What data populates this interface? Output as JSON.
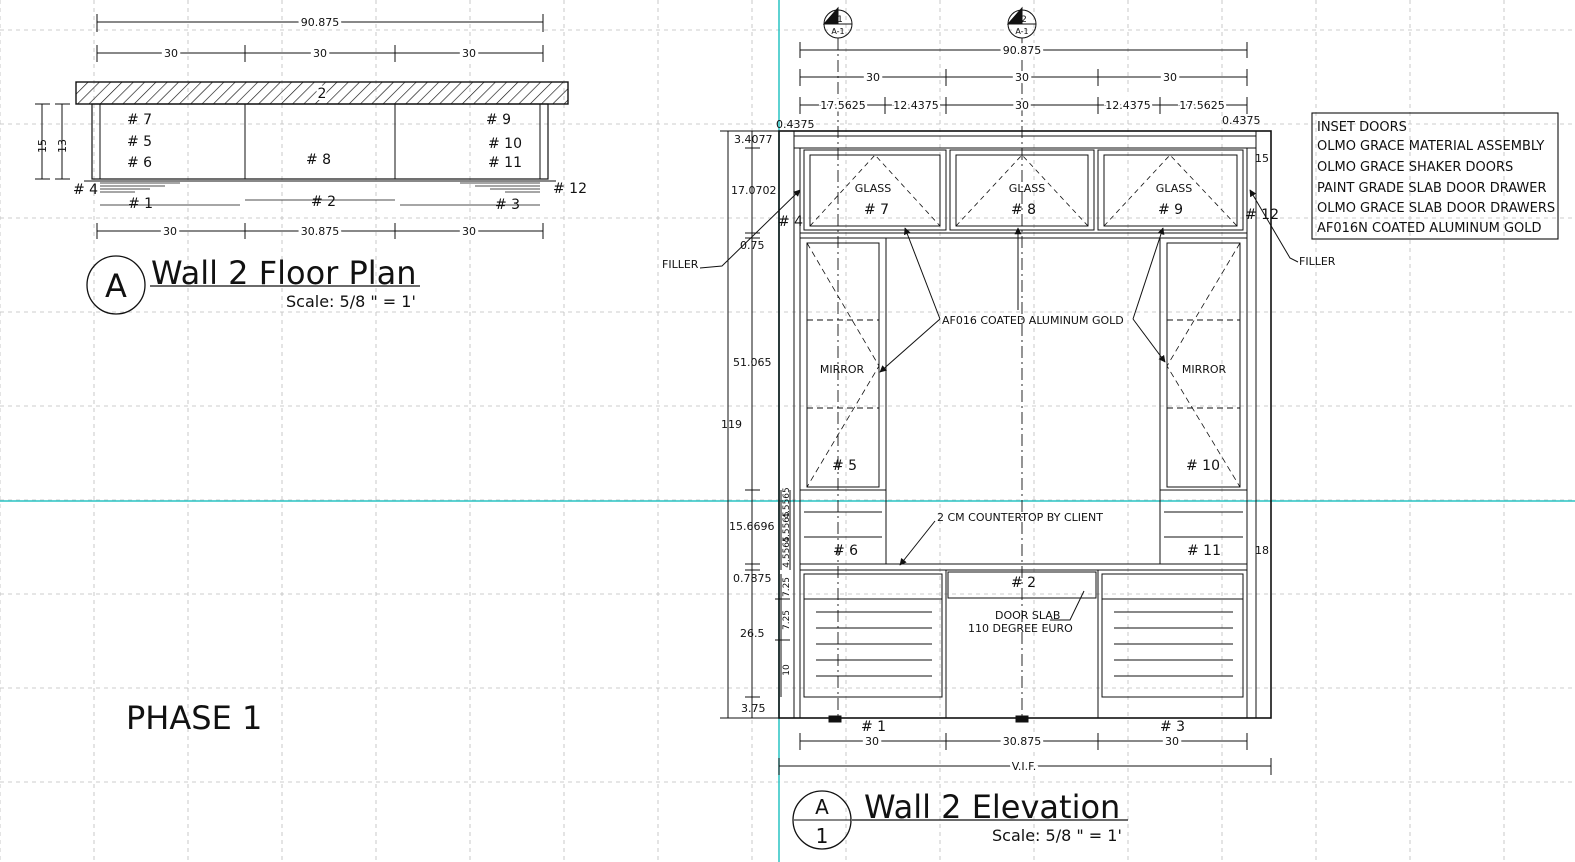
{
  "floor_plan": {
    "dims_top": {
      "overall": "90.875",
      "segments": [
        "30",
        "30",
        "30"
      ]
    },
    "dims_bottom": [
      "30",
      "30.875",
      "30"
    ],
    "dims_side": [
      "15",
      "13"
    ],
    "countertop_number": "2",
    "labels": {
      "n7": "# 7",
      "n5": "# 5",
      "n6": "# 6",
      "n8": "# 8",
      "n9": "# 9",
      "n10": "# 10",
      "n11": "# 11",
      "n4": "# 4",
      "n12": "# 12",
      "n1": "# 1",
      "n2": "# 2",
      "n3": "# 3"
    },
    "bubble_letter": "A",
    "title": "Wall 2 Floor Plan",
    "scale": "Scale: 5/8 \" = 1'"
  },
  "phase": "PHASE 1",
  "elevation": {
    "section_markers": [
      {
        "top": "1",
        "bottom": "A-1"
      },
      {
        "top": "2",
        "bottom": "A-1"
      }
    ],
    "dims_top": {
      "overall": "90.875",
      "row2": [
        "30",
        "30",
        "30"
      ],
      "row3": [
        "17.5625",
        "12.4375",
        "30",
        "12.4375",
        "17.5625"
      ],
      "corner_left": "0.4375",
      "corner_right": "0.4375"
    },
    "dims_left": {
      "overall": "119",
      "segments": [
        "3.4077",
        "17.0702",
        "0.75",
        "51.065",
        "15.6696",
        "0.7875",
        "26.5",
        "3.75"
      ],
      "small": [
        "4.5565",
        "4.5565",
        "4.5565",
        "7.25",
        "7.25",
        "10"
      ]
    },
    "side_numbers": {
      "right_top": "15",
      "right_mid": "18"
    },
    "glass_label": "GLASS",
    "mirror_label": "MIRROR",
    "labels": {
      "n7": "# 7",
      "n8": "# 8",
      "n9": "# 9",
      "n4": "# 4",
      "n12": "# 12",
      "n5": "# 5",
      "n10": "# 10",
      "n6": "# 6",
      "n11": "# 11",
      "n2": "# 2",
      "n1": "# 1",
      "n3": "# 3"
    },
    "notes": {
      "filler_left": "FILLER",
      "filler_right": "FILLER",
      "aluminum": "AF016 COATED ALUMINUM GOLD",
      "countertop": "2 CM COUNTERTOP BY CLIENT",
      "door_slab": "DOOR SLAB",
      "hinge": "110 DEGREE EURO"
    },
    "dims_bottom": [
      "30",
      "30.875",
      "30"
    ],
    "vif": "V.I.F.",
    "bubble_letter": "A",
    "bubble_number": "1",
    "title": "Wall 2 Elevation",
    "scale": "Scale: 5/8 \" = 1'"
  },
  "legend": {
    "items": [
      "INSET DOORS",
      "OLMO GRACE MATERIAL ASSEMBLY",
      "OLMO GRACE SHAKER DOORS",
      "PAINT GRADE SLAB DOOR DRAWER",
      "OLMO GRACE SLAB DOOR DRAWERS",
      "AF016N COATED ALUMINUM GOLD"
    ]
  },
  "colors": {
    "grid": "#bdbdbd",
    "guide": "#29c4c4",
    "ink": "#111111"
  }
}
